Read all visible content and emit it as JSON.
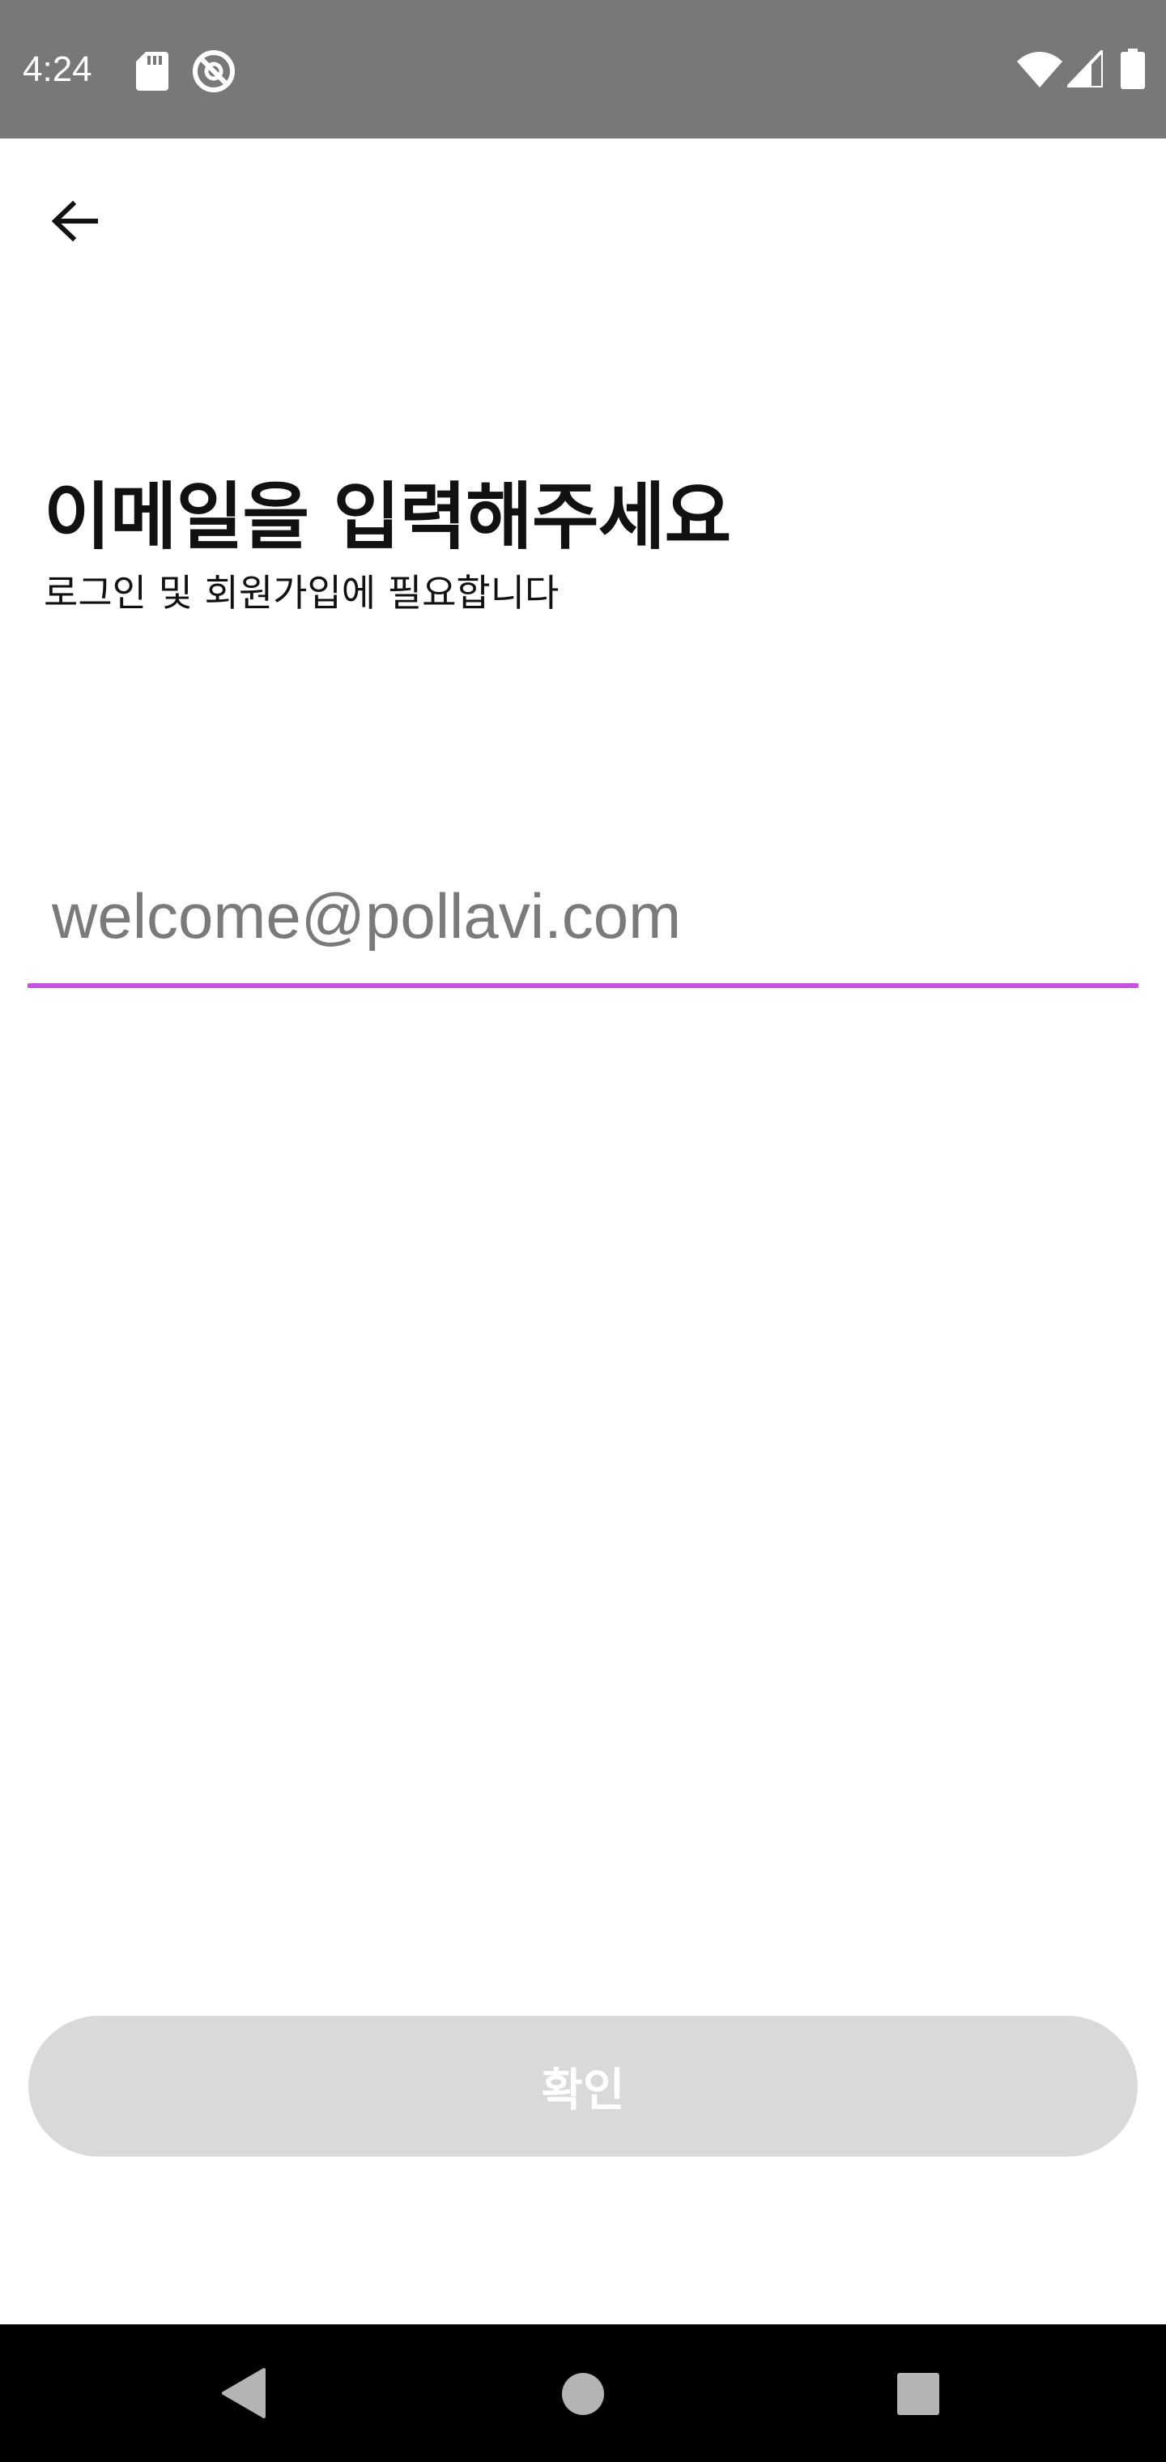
{
  "status_bar": {
    "time": "4:24",
    "background": "#787878",
    "left_icons": [
      "sd-card-icon",
      "no-disturb-icon"
    ],
    "right_icons": [
      "wifi-icon",
      "cellular-signal-icon",
      "battery-icon"
    ]
  },
  "header": {
    "back_icon": "arrow-left-icon"
  },
  "main": {
    "title": "이메일을 입력해주세요",
    "subtitle": "로그인 및 회원가입에 필요합니다",
    "email_input": {
      "value": "",
      "placeholder": "welcome@pollavi.com",
      "underline_color": "#c653e0"
    },
    "confirm_button": {
      "label": "확인",
      "background": "#d9d9d9",
      "text_color": "#ffffff",
      "enabled": false
    }
  },
  "nav_bar": {
    "buttons": [
      "back-triangle-icon",
      "home-circle-icon",
      "recents-square-icon"
    ]
  }
}
